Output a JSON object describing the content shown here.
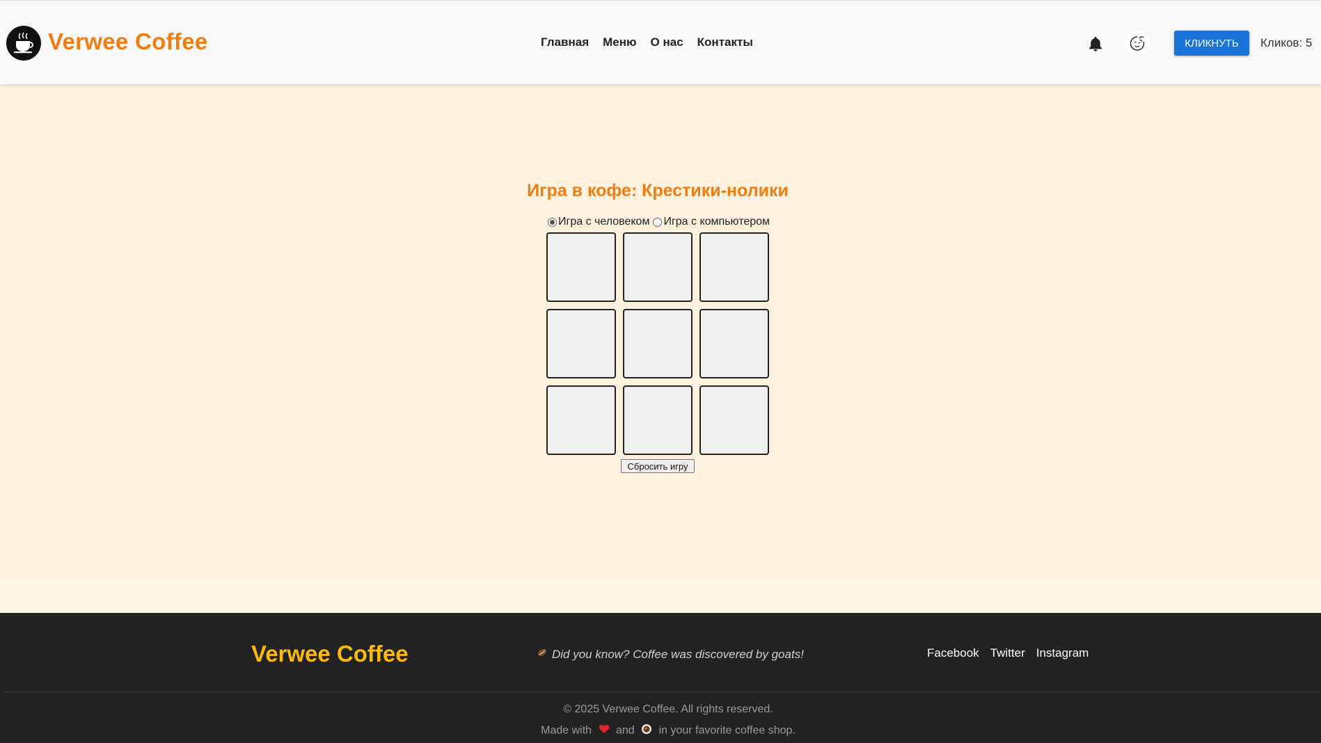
{
  "header": {
    "brand": "Verwee Coffee",
    "nav": [
      "Главная",
      "Меню",
      "О нас",
      "Контакты"
    ],
    "click_button": "КЛИКНУТЬ",
    "click_count": "Кликов: 5"
  },
  "game": {
    "title": "Игра в кофе: Крестики-нолики",
    "modes": [
      {
        "label": "Игра с человеком",
        "selected": true
      },
      {
        "label": "Игра с компьютером",
        "selected": false
      }
    ],
    "board": [
      "",
      "",
      "",
      "",
      "",
      "",
      "",
      "",
      ""
    ],
    "reset_label": "Сбросить игру"
  },
  "footer": {
    "brand": "Verwee Coffee",
    "fact": "Did you know? Coffee was discovered by goats!",
    "social": [
      "Facebook",
      "Twitter",
      "Instagram"
    ],
    "copyright": "© 2025 Verwee Coffee. All rights reserved.",
    "made_with": {
      "prefix": "Made with",
      "middle": "and",
      "suffix": "in your favorite coffee shop."
    }
  },
  "colors": {
    "accent": "#f07d12",
    "footer_brand": "#f9b90f",
    "button": "#1a73d9",
    "page_bg": "#fef1dd",
    "footer_bg": "#222222"
  },
  "icons": [
    "coffee-cup-logo-icon",
    "bell-icon",
    "avatar-icon",
    "coffee-bean-icon",
    "heart-icon",
    "coffee-icon"
  ]
}
